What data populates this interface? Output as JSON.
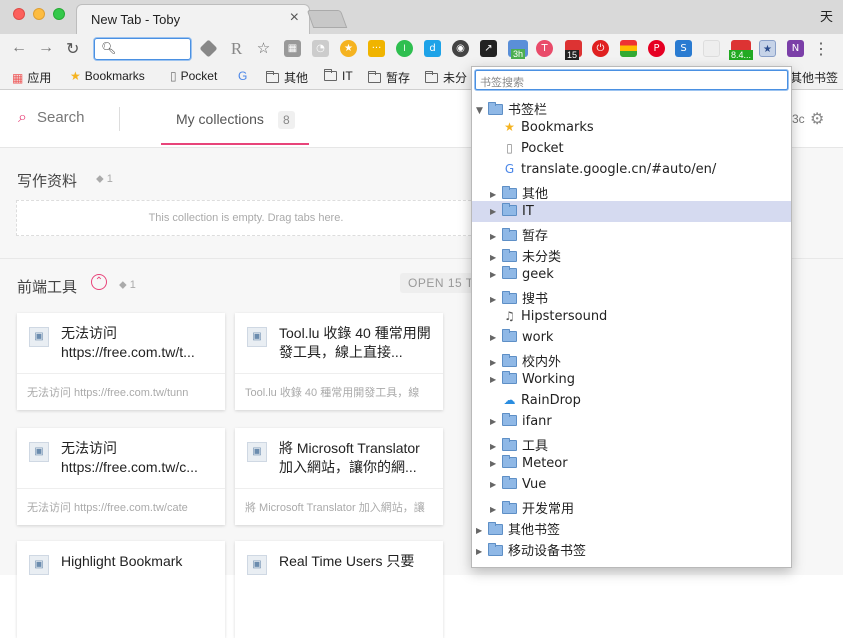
{
  "browser": {
    "tab_title": "New Tab - Toby",
    "tab_close": "×",
    "corner_char": "天",
    "menu": "⋮"
  },
  "bookmarks_bar": {
    "apps": "应用",
    "items": [
      "Bookmarks",
      "Pocket",
      "其他",
      "IT",
      "暂存",
      "未分"
    ],
    "overflow": "其他书签"
  },
  "extensions": {
    "badge_15": "15",
    "badge_3h": "3h",
    "badge_84": "8.4..."
  },
  "toby": {
    "search_label": "Search",
    "my_collections_label": "My collections",
    "my_collections_count": "8",
    "top_right_fragment": "3c",
    "collections": [
      {
        "name": "写作资料",
        "tag_count": "1",
        "empty_text": "This collection is empty. Drag tabs here."
      },
      {
        "name": "前端工具",
        "tag_count": "1",
        "open_label": "OPEN 15 T",
        "cards": [
          {
            "title": "无法访问 https://free.com.tw/t...",
            "desc": "无法访问 https://free.com.tw/tunn"
          },
          {
            "title": "Tool.lu 收錄 40 種常用開發工具，線上直接...",
            "desc": "Tool.lu 收錄 40 種常用開發工具，線"
          },
          {
            "title": "无法访问 https://free.com.tw/c...",
            "desc": "无法访问 https://free.com.tw/cate"
          },
          {
            "title": "將 Microsoft Translator 加入網站，讓你的網...",
            "desc": "將 Microsoft Translator 加入網站，讓"
          },
          {
            "title": "Highlight Bookmark",
            "desc": ""
          },
          {
            "title": "Real Time Users 只要",
            "desc": ""
          }
        ]
      }
    ]
  },
  "popup": {
    "search_placeholder": "书签搜索",
    "tree": [
      {
        "label": "书签栏",
        "type": "folder",
        "depth": 0,
        "expanded": true
      },
      {
        "label": "Bookmarks",
        "type": "star",
        "depth": 1
      },
      {
        "label": "Pocket",
        "type": "page",
        "depth": 1
      },
      {
        "label": "translate.google.cn/#auto/en/",
        "type": "translate",
        "depth": 1
      },
      {
        "label": "其他",
        "type": "folder",
        "depth": 1
      },
      {
        "label": "IT",
        "type": "folder",
        "depth": 1,
        "selected": true
      },
      {
        "label": "暂存",
        "type": "folder",
        "depth": 1
      },
      {
        "label": "未分类",
        "type": "folder",
        "depth": 1
      },
      {
        "label": "geek",
        "type": "folder",
        "depth": 1
      },
      {
        "label": "搜书",
        "type": "folder",
        "depth": 1
      },
      {
        "label": "Hipstersound",
        "type": "sound",
        "depth": 1
      },
      {
        "label": "work",
        "type": "folder",
        "depth": 1
      },
      {
        "label": "校内外",
        "type": "folder",
        "depth": 1
      },
      {
        "label": "Working",
        "type": "folder",
        "depth": 1
      },
      {
        "label": "RainDrop",
        "type": "cloud",
        "depth": 1
      },
      {
        "label": "ifanr",
        "type": "folder",
        "depth": 1
      },
      {
        "label": "工具",
        "type": "folder",
        "depth": 1
      },
      {
        "label": "Meteor",
        "type": "folder",
        "depth": 1
      },
      {
        "label": "Vue",
        "type": "folder",
        "depth": 1
      },
      {
        "label": "开发常用",
        "type": "folder",
        "depth": 1
      },
      {
        "label": "其他书签",
        "type": "folder",
        "depth": 0
      },
      {
        "label": "移动设备书签",
        "type": "folder",
        "depth": 0
      }
    ]
  },
  "colors": {
    "accent": "#e8447a",
    "selection": "#d5daf0",
    "folder": "#8fb8e6"
  }
}
